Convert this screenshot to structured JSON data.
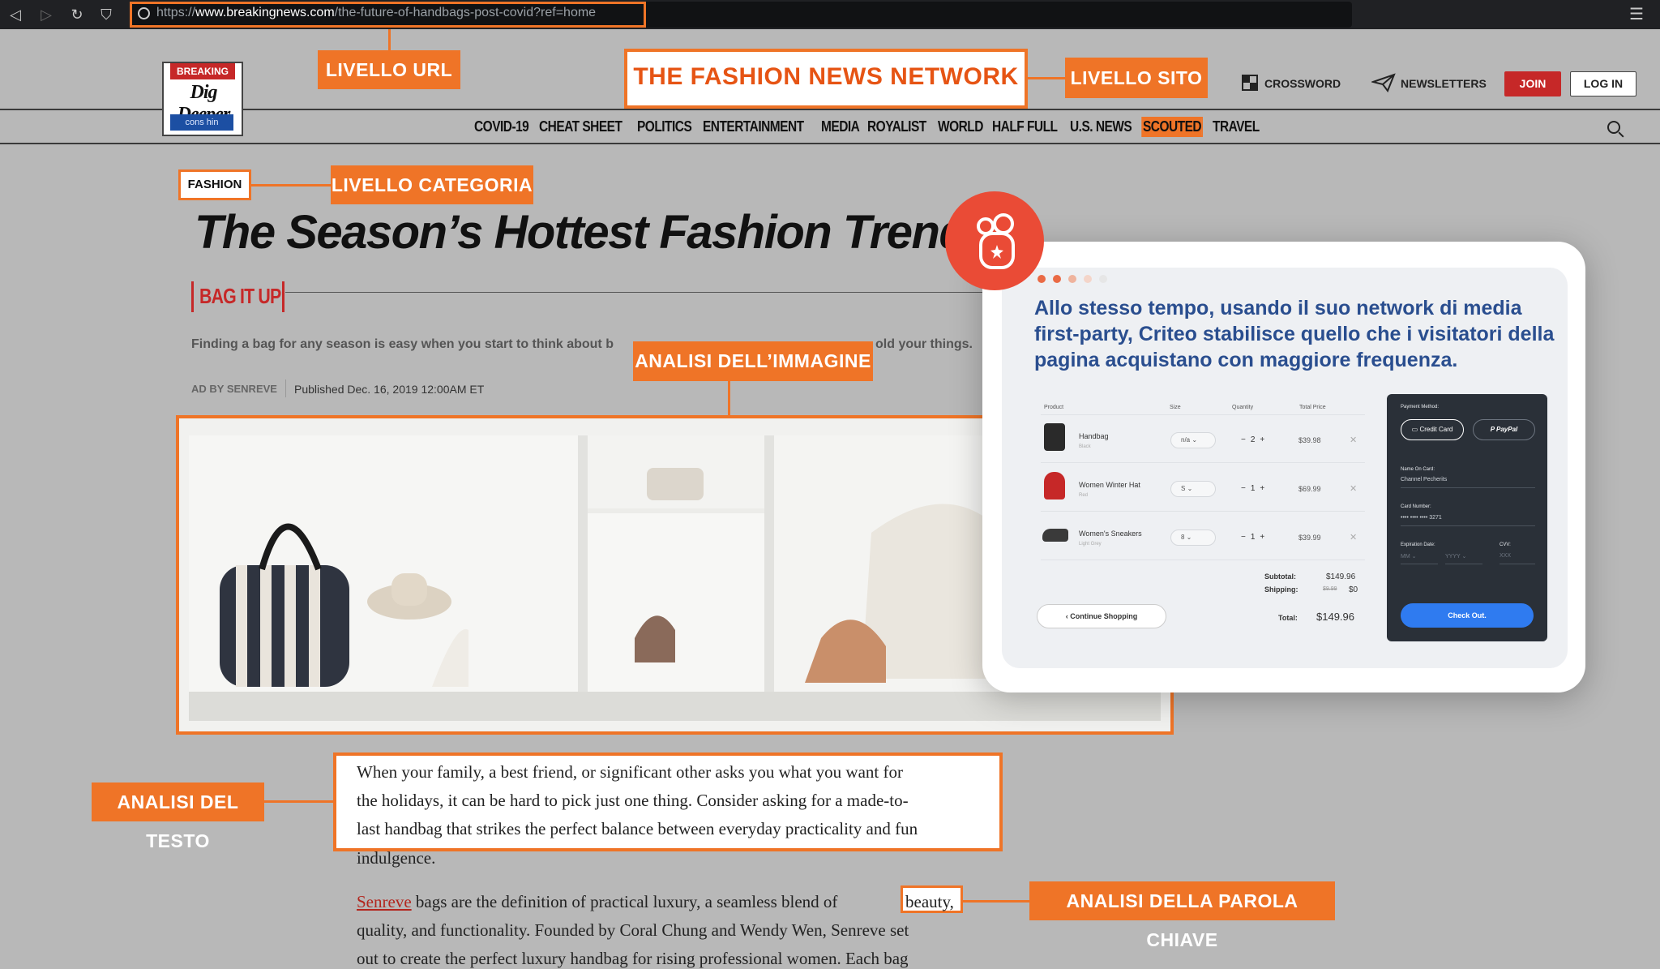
{
  "browser": {
    "url_scheme": "https://",
    "url_domain": "www.breakingnews.com",
    "url_path": "/the-future-of-handbags-post-covid?ref=home"
  },
  "logo": {
    "badge": "BREAKING",
    "wordmark": "Dig Deeper",
    "sub": "cons hin"
  },
  "site_title": "THE FASHION NEWS NETWORK",
  "header": {
    "crossword": "CROSSWORD",
    "newsletters": "NEWSLETTERS",
    "join": "JOIN",
    "login": "LOG IN"
  },
  "nav": [
    "COVID-19",
    "CHEAT SHEET",
    "POLITICS",
    "ENTERTAINMENT",
    "MEDIA",
    "ROYALIST",
    "WORLD",
    "HALF FULL",
    "U.S. NEWS",
    "SCOUTED",
    "TRAVEL"
  ],
  "annotations": {
    "url_level": "LIVELLO URL",
    "site_level": "LIVELLO SITO",
    "category_level": "LIVELLO CATEGORIA",
    "image_analysis": "ANALISI DELL’IMMAGINE",
    "text_analysis": "ANALISI DEL TESTO",
    "keyword_analysis": "ANALISI DELLA PAROLA CHIAVE"
  },
  "article": {
    "category": "FASHION",
    "headline": "The Season’s Hottest Fashion Trends",
    "kicker": "BAG IT UP",
    "deck_left": "Finding a bag for any season is easy when you start to think about b",
    "deck_right": "old your things.",
    "ad_by": "AD BY SENREVE",
    "published": "Published Dec. 16, 2019 12:00AM ET",
    "para1_lines": [
      "When your family, a best friend, or significant other asks you what you want for",
      "the holidays, it can be hard to pick just one thing. Consider asking for a made-to-",
      "last handbag that strikes the perfect balance between everyday practicality and fun",
      "indulgence."
    ],
    "para2_link": "Senreve",
    "para2_line1": " bags are the definition of practical luxury, a seamless blend of ",
    "keyword": "beauty,",
    "para2_line2": "quality, and functionality. Founded by Coral Chung and Wendy Wen, Senreve set",
    "para2_line3": "out to create the perfect luxury handbag for rising professional women. Each bag"
  },
  "ad": {
    "text": "Allo stesso tempo, usando il suo network di media first-party, Criteo stabilisce quello che i visitatori della pagina acquistano con maggiore frequenza.",
    "cart": {
      "headers": [
        "Product",
        "Size",
        "Quantity",
        "Total Price"
      ],
      "items": [
        {
          "name": "Handbag",
          "variant": "Black",
          "size": "n/a",
          "qty": "2",
          "price": "$39.98",
          "color": "#2a2a2a"
        },
        {
          "name": "Women Winter Hat",
          "variant": "Red",
          "size": "S",
          "qty": "1",
          "price": "$69.99",
          "color": "#c62828"
        },
        {
          "name": "Women's Sneakers",
          "variant": "Light Grey",
          "size": "8",
          "qty": "1",
          "price": "$39.99",
          "color": "#3a3a3a"
        }
      ],
      "subtotal_label": "Subtotal:",
      "subtotal": "$149.96",
      "shipping_label": "Shipping:",
      "shipping_old": "$9.99",
      "shipping": "$0",
      "total_label": "Total:",
      "total": "$149.96",
      "continue": "Continue Shopping"
    },
    "payment": {
      "method_label": "Payment Method:",
      "credit_card": "Credit Card",
      "paypal": "PayPal",
      "name_label": "Name On Card:",
      "name": "Channel Pecherits",
      "number_label": "Card Number:",
      "number": "•••• •••• •••• 3271",
      "exp_label": "Expiration Date:",
      "mm": "MM",
      "yyyy": "YYYY",
      "cvv_label": "CVV:",
      "cvv": "XXX",
      "checkout": "Check Out."
    }
  }
}
